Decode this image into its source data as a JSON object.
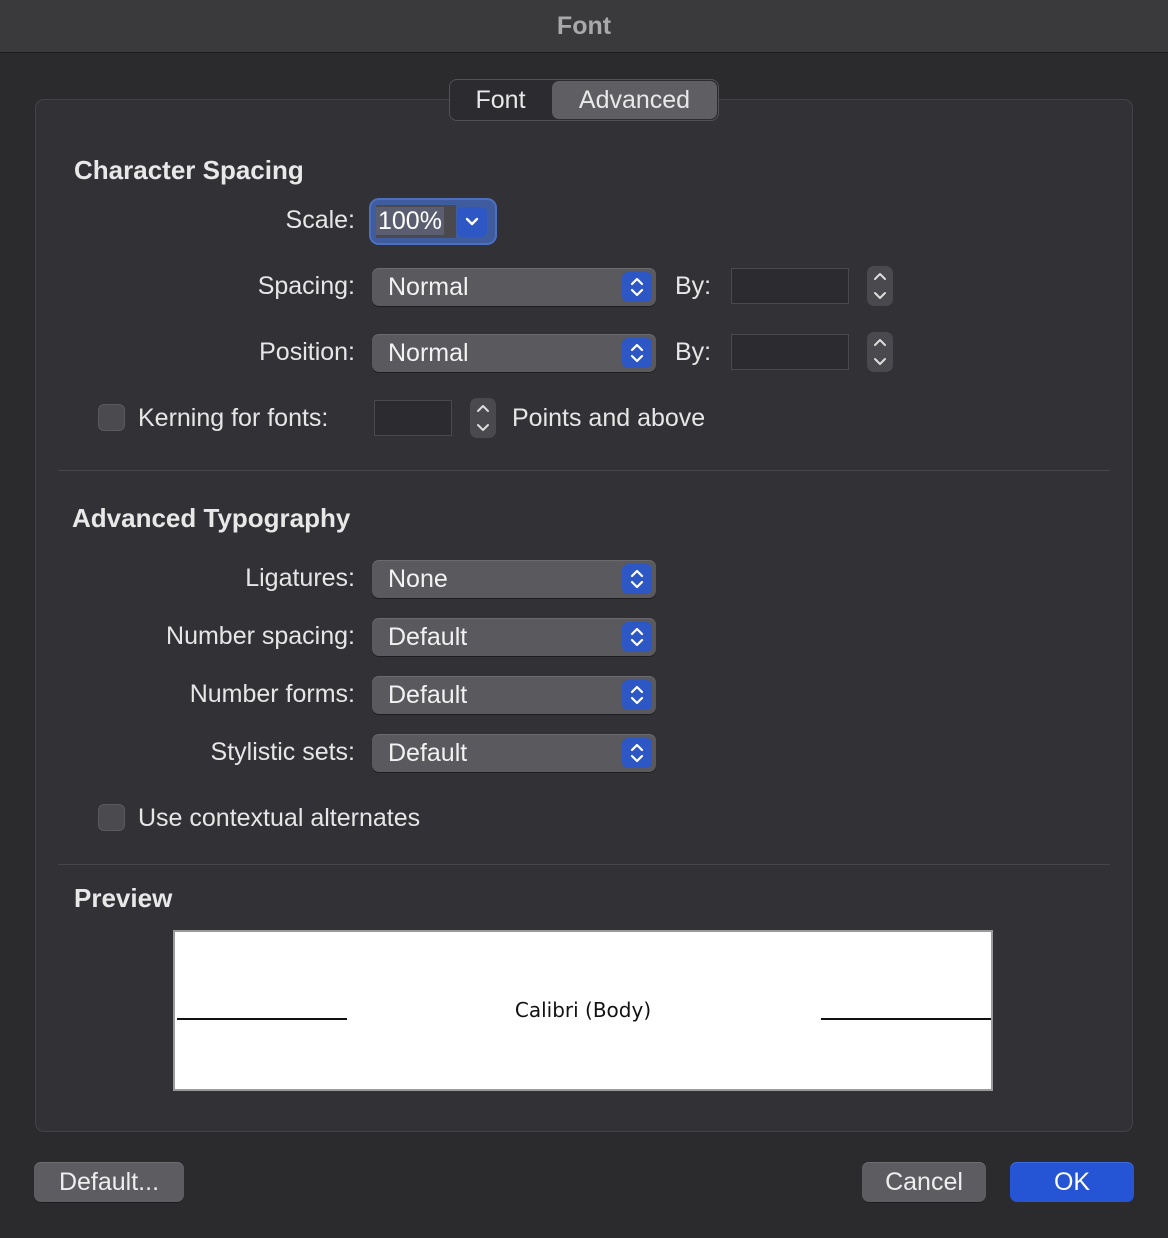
{
  "window": {
    "title": "Font"
  },
  "tabs": [
    {
      "label": "Font",
      "selected": false
    },
    {
      "label": "Advanced",
      "selected": true
    }
  ],
  "character_spacing": {
    "heading": "Character Spacing",
    "scale_label": "Scale:",
    "scale_value": "100%",
    "spacing_label": "Spacing:",
    "spacing_value": "Normal",
    "spacing_by_label": "By:",
    "spacing_by_value": "",
    "position_label": "Position:",
    "position_value": "Normal",
    "position_by_label": "By:",
    "position_by_value": "",
    "kerning_label": "Kerning for fonts:",
    "kerning_checked": false,
    "kerning_value": "",
    "kerning_suffix": "Points and above"
  },
  "advanced_typography": {
    "heading": "Advanced Typography",
    "ligatures_label": "Ligatures:",
    "ligatures_value": "None",
    "number_spacing_label": "Number spacing:",
    "number_spacing_value": "Default",
    "number_forms_label": "Number forms:",
    "number_forms_value": "Default",
    "stylistic_sets_label": "Stylistic sets:",
    "stylistic_sets_value": "Default",
    "contextual_label": "Use contextual alternates",
    "contextual_checked": false
  },
  "preview": {
    "heading": "Preview",
    "text": "Calibri (Body)"
  },
  "buttons": {
    "default_label": "Default...",
    "cancel_label": "Cancel",
    "ok_label": "OK"
  },
  "colors": {
    "accent": "#2555d4",
    "background": "#2b2a2d"
  }
}
